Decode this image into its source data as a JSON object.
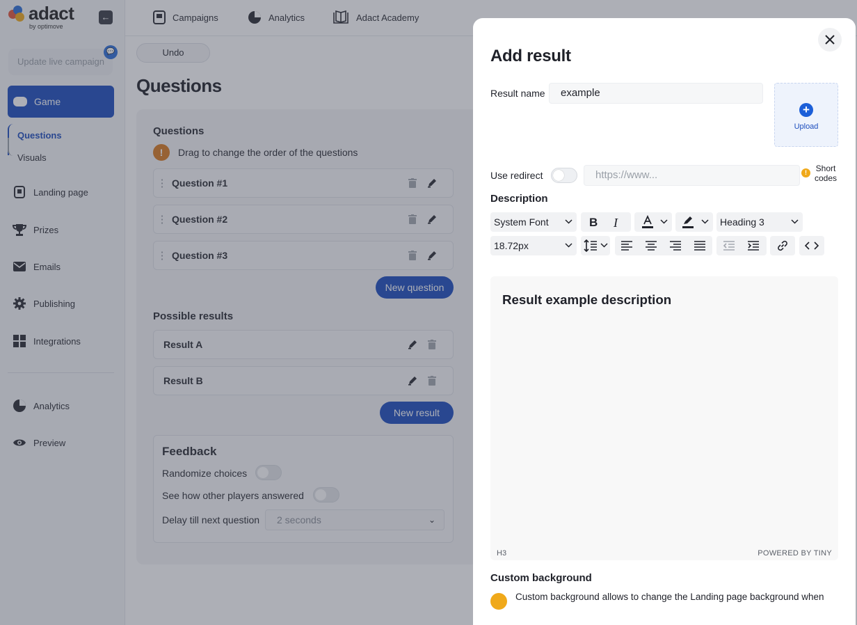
{
  "brand": {
    "name": "adact",
    "byline": "by optimove"
  },
  "sidebar": {
    "live_campaign_placeholder": "Update live campaign",
    "game_label": "Game",
    "sub_items": [
      "Questions",
      "Visuals"
    ],
    "items": [
      {
        "label": "Landing page",
        "icon": "page-icon"
      },
      {
        "label": "Prizes",
        "icon": "trophy-icon"
      },
      {
        "label": "Emails",
        "icon": "mail-icon"
      },
      {
        "label": "Publishing",
        "icon": "gear-icon"
      },
      {
        "label": "Integrations",
        "icon": "grid-icon"
      },
      {
        "label": "Analytics",
        "icon": "pie-icon"
      },
      {
        "label": "Preview",
        "icon": "eye-icon"
      }
    ]
  },
  "topnav": {
    "campaigns": "Campaigns",
    "analytics": "Analytics",
    "academy": "Adact Academy"
  },
  "main": {
    "undo": "Undo",
    "title": "Questions",
    "questions_heading": "Questions",
    "drag_hint": "Drag to change the order of the questions",
    "questions": [
      "Question #1",
      "Question #2",
      "Question #3"
    ],
    "new_question": "New question",
    "results_heading": "Possible results",
    "results": [
      "Result A",
      "Result B"
    ],
    "new_result": "New result",
    "feedback": {
      "title": "Feedback",
      "randomize": "Randomize choices",
      "see_others": "See how other players answered",
      "delay_label": "Delay till next question",
      "delay_value": "2 seconds"
    }
  },
  "modal": {
    "title": "Add result",
    "result_name_label": "Result name",
    "result_name_value": "example",
    "upload_label": "Upload",
    "use_redirect_label": "Use redirect",
    "redirect_placeholder": "https://www...",
    "short_codes": "Short codes",
    "description_label": "Description",
    "toolbar": {
      "font": "System Font",
      "block": "Heading 3",
      "size": "18.72px"
    },
    "editor_content": "Result example description",
    "editor_path": "H3",
    "powered_by": "POWERED BY TINY",
    "custom_bg_label": "Custom background",
    "custom_bg_note": "Custom background allows to change the Landing page background when"
  },
  "colors": {
    "primary": "#1c4dbd",
    "warning": "#f0a91a",
    "info_orange": "#d97a1f"
  }
}
